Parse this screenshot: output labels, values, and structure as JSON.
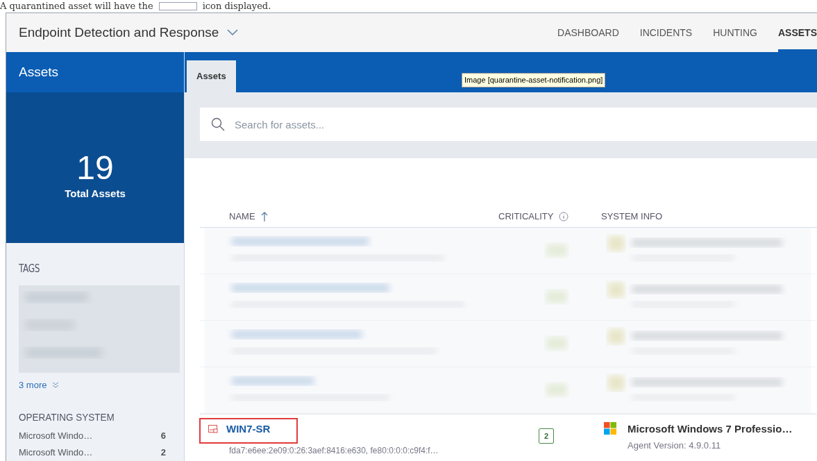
{
  "caption": {
    "before": "A quarantined asset will have the",
    "after": "icon displayed."
  },
  "header": {
    "product": "Endpoint Detection and Response",
    "nav": [
      {
        "label": "DASHBOARD",
        "selected": false
      },
      {
        "label": "INCIDENTS",
        "selected": false
      },
      {
        "label": "HUNTING",
        "selected": false
      },
      {
        "label": "ASSETS",
        "selected": true
      }
    ]
  },
  "sidebar": {
    "title": "Assets",
    "total": "19",
    "total_label": "Total Assets",
    "tags": {
      "title": "TAGS",
      "more": "3 more"
    },
    "operating_system": {
      "title": "OPERATING SYSTEM",
      "items": [
        {
          "name": "Microsoft Windo…",
          "count": "6"
        },
        {
          "name": "Microsoft Windo…",
          "count": "2"
        }
      ]
    }
  },
  "tabs": [
    {
      "label": "Assets",
      "selected": true
    }
  ],
  "tooltip": "Image [quarantine-asset-notification.png]",
  "search": {
    "placeholder": "Search for assets..."
  },
  "table": {
    "columns": [
      {
        "label": "NAME",
        "sorted": true
      },
      {
        "label": "CRITICALITY",
        "info": true
      },
      {
        "label": "SYSTEM INFO"
      }
    ],
    "rows": [
      {
        "name": "WIN7-SR",
        "quarantined": true,
        "address": "fda7:e6ee:2e09:0:26:3aef:8416:e630, fe80:0:0:0:c9f4:f…",
        "criticality": "2",
        "os": "Microsoft Windows 7 Professio…",
        "agent": "Agent Version: 4.9.0.11"
      }
    ]
  }
}
